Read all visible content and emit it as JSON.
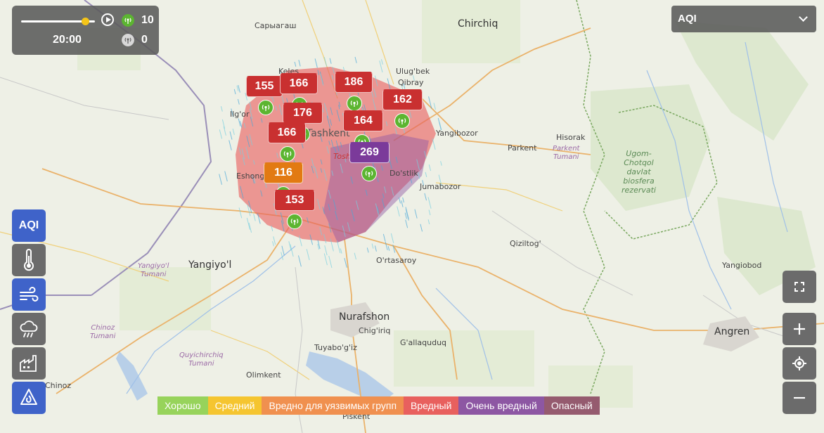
{
  "timeline": {
    "time": "20:00",
    "slider_position": 0.87,
    "online_count": "10",
    "offline_count": "0"
  },
  "layer_select": {
    "value": "AQI"
  },
  "layers": [
    {
      "id": "aqi",
      "label": "AQI",
      "icon": "aqi-text",
      "active": true
    },
    {
      "id": "temperature",
      "icon": "thermometer-icon",
      "active": false
    },
    {
      "id": "wind",
      "icon": "wind-icon",
      "active": true
    },
    {
      "id": "precipitation",
      "icon": "rain-cloud-icon",
      "active": false
    },
    {
      "id": "industry",
      "icon": "factory-icon",
      "active": false
    },
    {
      "id": "fire",
      "icon": "fire-icon",
      "active": true
    }
  ],
  "legend": [
    {
      "label": "Хорошо",
      "color": "#97d35b"
    },
    {
      "label": "Средний",
      "color": "#f5c530"
    },
    {
      "label": "Вредно для уязвимых групп",
      "color": "#f0904f"
    },
    {
      "label": "Вредный",
      "color": "#e8605e"
    },
    {
      "label": "Очень вредный",
      "color": "#8d57a3"
    },
    {
      "label": "Опасный",
      "color": "#955b6f"
    }
  ],
  "stations": [
    {
      "aqi": "155",
      "color": "#c93030"
    },
    {
      "aqi": "166",
      "color": "#c93030"
    },
    {
      "aqi": "186",
      "color": "#c93030"
    },
    {
      "aqi": "162",
      "color": "#c93030"
    },
    {
      "aqi": "176",
      "color": "#c93030"
    },
    {
      "aqi": "164",
      "color": "#c93030"
    },
    {
      "aqi": "166",
      "color": "#c93030"
    },
    {
      "aqi": "269",
      "color": "#7b3a9a"
    },
    {
      "aqi": "116",
      "color": "#e27a12"
    },
    {
      "aqi": "153",
      "color": "#c93030"
    }
  ],
  "places": {
    "saryagash": "Сарыагаш",
    "chirchiq": "Chirchiq",
    "keles": "Keles",
    "ulugbek": "Ulug'bek",
    "qibray": "Qibray",
    "ilgor": "Ilg'or",
    "tashkent": "Tashkent",
    "tosh": "Tosh",
    "yangibozor": "Yangibozor",
    "hisorak": "Hisorak",
    "parkent": "Parkent",
    "parkent_tumani": "Parkent\nTumani",
    "reserve": "Ugom-\nChotqol\ndavlat\nbiosfera\nrezervati",
    "eshon": "Eshong",
    "dostlik": "Do'stlik",
    "jumabozor": "Jumabozor",
    "qiziltog": "Qiziltog'",
    "ortasaroy": "O'rtasaroy",
    "yangiyol": "Yangiyo'l",
    "yangiyol_tumani": "Yangiyo'l\nTumani",
    "yangiobod": "Yangiobod",
    "nurafshon": "Nurafshon",
    "chigiriq": "Chig'iriq",
    "gallaquduq": "G'allaquduq",
    "tuyabogiz": "Tuyabo'g'iz",
    "angren": "Angren",
    "chinoz_tumani": "Chinoz\nTumani",
    "quyichirchiq": "Quyichirchiq\nTumani",
    "olimkent": "Olimkent",
    "chinoz": "Chinoz",
    "piskent": "Piskent"
  }
}
